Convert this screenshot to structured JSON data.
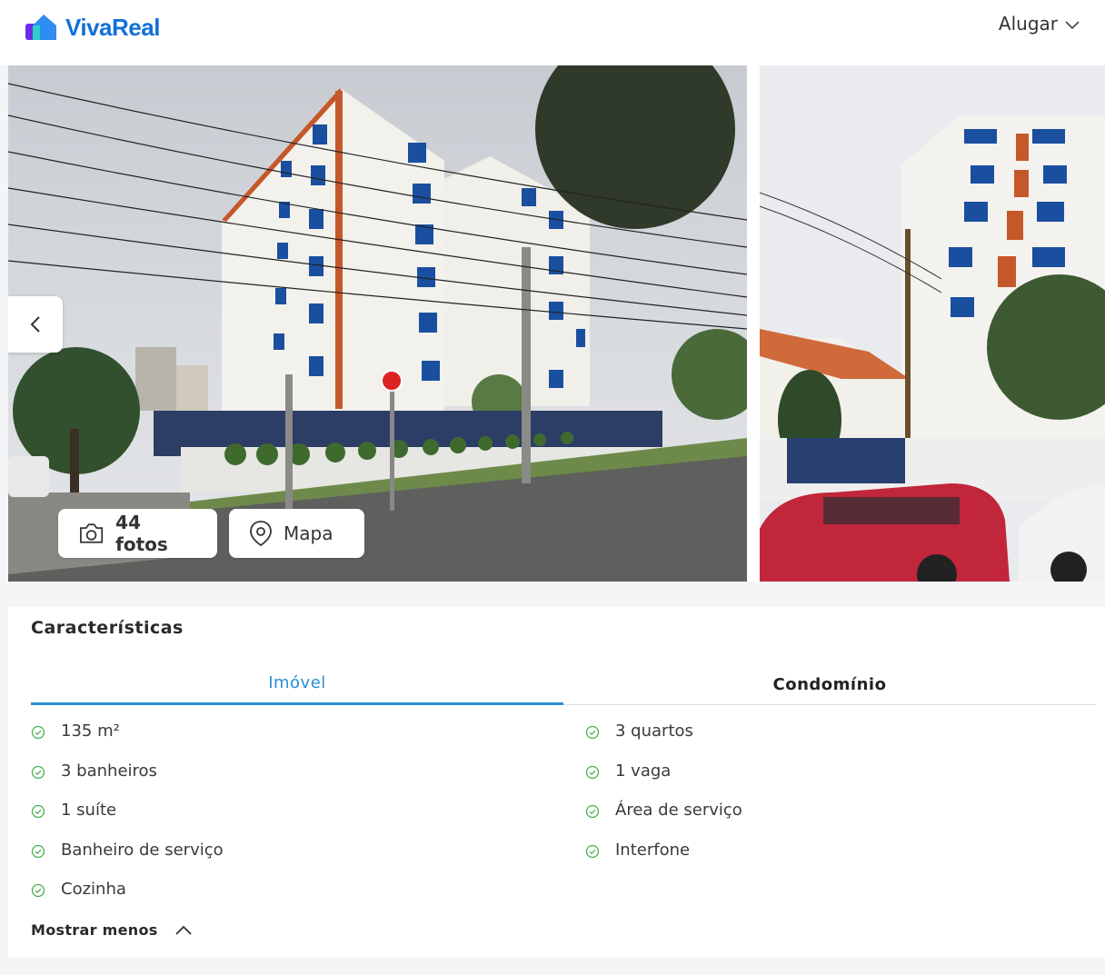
{
  "header": {
    "brand": "VivaReal",
    "menu_label": "Alugar"
  },
  "gallery": {
    "photos_button": "44 fotos",
    "map_button": "Mapa"
  },
  "features": {
    "title": "Características",
    "tabs": [
      {
        "label": "Imóvel",
        "active": true
      },
      {
        "label": "Condomínio",
        "active": false
      }
    ],
    "left_items": [
      "135 m²",
      "3 banheiros",
      "1 suíte",
      "Banheiro de serviço",
      "Cozinha"
    ],
    "right_items": [
      "3 quartos",
      "1 vaga",
      "Área de serviço",
      "Interfone"
    ],
    "toggle_label": "Mostrar menos"
  },
  "colors": {
    "brand_blue": "#1270d9",
    "tab_active": "#2a8fd4",
    "check_green": "#4caf50"
  },
  "icons": {
    "logo": "house-logo-icon",
    "menu": "chevron-down-icon",
    "prev": "chevron-left-icon",
    "photos": "camera-icon",
    "map": "map-pin-icon",
    "feature": "check-circle-icon",
    "collapse": "chevron-up-icon"
  }
}
